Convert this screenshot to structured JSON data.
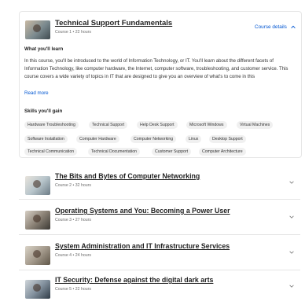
{
  "course1": {
    "title": "Technical Support Fundamentals",
    "meta": "Course 1 • 22 hours",
    "details_label": "Course details",
    "what_learn_heading": "What you'll learn",
    "description": "In this course, you'll be introduced to the world of Information Technology, or IT. You'll learn about the different facets of Information Technology, like computer hardware, the Internet, computer software, troubleshooting, and customer service. This course covers a wide variety of topics in IT that are designed to give you an overview of what's to come in this",
    "read_more": "Read more",
    "skills_heading": "Skills you'll gain",
    "skills": [
      "Hardware Troubleshooting",
      "Technical Support",
      "Help Desk Support",
      "Microsoft Windows",
      "Virtual Machines",
      "Software Installation",
      "Computer Hardware",
      "Computer Networking",
      "Linux",
      "Desktop Support",
      "Technical Communication",
      "Technical Documentation",
      "Customer Support",
      "Computer Architecture"
    ]
  },
  "courses": [
    {
      "title": "The Bits and Bytes of Computer Networking",
      "meta": "Course 2 • 32 hours"
    },
    {
      "title": "Operating Systems and You: Becoming a Power User",
      "meta": "Course 3 • 27 hours"
    },
    {
      "title": "System Administration and IT Infrastructure Services",
      "meta": "Course 4 • 24 hours"
    },
    {
      "title": "IT Security: Defense against the digital dark arts",
      "meta": "Course 5 • 22 hours"
    }
  ],
  "icons": {
    "expanded_chevron": "chevron-up-icon",
    "collapsed_chevron": "chevron-down-icon"
  },
  "colors": {
    "link": "#0056d2",
    "text": "#1f1f1f",
    "chip_bg": "#f0f0f0"
  }
}
